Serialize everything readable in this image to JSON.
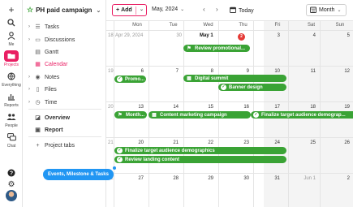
{
  "rail": {
    "items": [
      {
        "icon": "plus-icon",
        "label": ""
      },
      {
        "icon": "search-icon",
        "label": ""
      },
      {
        "icon": "me-icon",
        "label": "Me"
      },
      {
        "icon": "projects-icon",
        "label": "Projects"
      },
      {
        "icon": "everything-icon",
        "label": "Everything"
      },
      {
        "icon": "reports-icon",
        "label": "Reports"
      },
      {
        "icon": "people-icon",
        "label": "People"
      },
      {
        "icon": "chat-icon",
        "label": "Chat"
      }
    ],
    "help_icon": "help-icon",
    "settings_icon": "gear-icon",
    "avatar_icon": "avatar"
  },
  "sidebar": {
    "project_name": "PH paid campaign",
    "items": [
      {
        "label": "Tasks",
        "icon": "tasks-icon",
        "caret": true
      },
      {
        "label": "Discussions",
        "icon": "discussions-icon",
        "caret": true
      },
      {
        "label": "Gantt",
        "icon": "gantt-icon",
        "caret": false
      },
      {
        "label": "Calendar",
        "icon": "calendar-icon",
        "caret": false
      },
      {
        "label": "Notes",
        "icon": "notes-icon",
        "caret": true
      },
      {
        "label": "Files",
        "icon": "files-icon",
        "caret": true
      },
      {
        "label": "Time",
        "icon": "time-icon",
        "caret": true
      },
      {
        "label": "Overview",
        "icon": "overview-icon",
        "caret": false
      },
      {
        "label": "Report",
        "icon": "report-icon",
        "caret": false
      },
      {
        "label": "Project tabs",
        "icon": "plus-icon",
        "caret": false
      }
    ],
    "active_item": "Calendar"
  },
  "toolbar": {
    "add_label": "Add",
    "month_label": "May, 2024",
    "today_label": "Today",
    "view_label": "Month"
  },
  "calendar": {
    "day_headers": [
      "Mon",
      "Tue",
      "Wed",
      "Thu",
      "Fri",
      "Sat",
      "Sun"
    ],
    "week_numbers": [
      "18",
      "19",
      "20",
      "21",
      "22"
    ],
    "weeks": [
      [
        "Apr 29, 2024",
        "30",
        "May 1",
        "2",
        "3",
        "4",
        "5"
      ],
      [
        "6",
        "7",
        "8",
        "9",
        "10",
        "11",
        "12"
      ],
      [
        "13",
        "14",
        "15",
        "16",
        "17",
        "18",
        "19"
      ],
      [
        "20",
        "21",
        "22",
        "23",
        "24",
        "25",
        "26"
      ],
      [
        "27",
        "28",
        "29",
        "30",
        "31",
        "Jun 1",
        "2"
      ]
    ],
    "today_badge": "2",
    "events": [
      {
        "title": "Review promotional...",
        "icon": "flag-icon"
      },
      {
        "title": "Promo...",
        "icon": "check-icon"
      },
      {
        "title": "Digital summit",
        "icon": "calendar-grid-icon"
      },
      {
        "title": "Banner design",
        "icon": "check-icon"
      },
      {
        "title": "Month...",
        "icon": "flag-icon"
      },
      {
        "title": "Content marketing campaign",
        "icon": "calendar-grid-icon"
      },
      {
        "title": "Finalize target audience demograp...",
        "icon": "check-icon"
      },
      {
        "title": "Finalize target audience demographics",
        "icon": "check-icon"
      },
      {
        "title": "Review landing content",
        "icon": "check-icon"
      }
    ]
  },
  "tooltip": {
    "label": "Events, Milestone & Tasks"
  },
  "colors": {
    "accent": "#e91e63",
    "event": "#3aa335",
    "badge": "#e53935",
    "tooltip": "#2196f3"
  }
}
